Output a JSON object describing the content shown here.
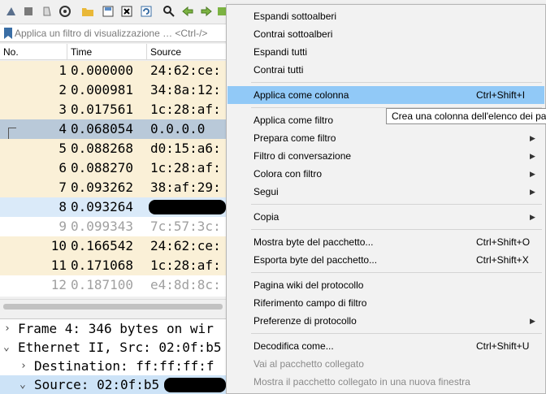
{
  "filter": {
    "placeholder": "Applica un filtro di visualizzazione … <Ctrl-/>"
  },
  "columns": {
    "no": "No.",
    "time": "Time",
    "source": "Source"
  },
  "packets": [
    {
      "no": "1",
      "time": "0.000000",
      "source": "24:62:ce:"
    },
    {
      "no": "2",
      "time": "0.000981",
      "source": "34:8a:12:"
    },
    {
      "no": "3",
      "time": "0.017561",
      "source": "1c:28:af:"
    },
    {
      "no": "4",
      "time": "0.068054",
      "source": "0.0.0.0"
    },
    {
      "no": "5",
      "time": "0.088268",
      "source": "d0:15:a6:"
    },
    {
      "no": "6",
      "time": "0.088270",
      "source": "1c:28:af:"
    },
    {
      "no": "7",
      "time": "0.093262",
      "source": "38:af:29:"
    },
    {
      "no": "8",
      "time": "0.093264",
      "source": ""
    },
    {
      "no": "9",
      "time": "0.099343",
      "source": "7c:57:3c:"
    },
    {
      "no": "10",
      "time": "0.166542",
      "source": "24:62:ce:"
    },
    {
      "no": "11",
      "time": "0.171068",
      "source": "1c:28:af:"
    },
    {
      "no": "12",
      "time": "0.187100",
      "source": "e4:8d:8c:"
    }
  ],
  "details": {
    "frame": "Frame 4: 346 bytes on wir",
    "ethernet": "Ethernet II, Src: 02:0f:b5",
    "destination": "Destination: ff:ff:ff:f",
    "source": "Source: 02:0f:b5"
  },
  "menu": {
    "expand_subtrees": "Espandi sottoalberi",
    "collapse_subtrees": "Contrai sottoalberi",
    "expand_all": "Espandi tutti",
    "collapse_all": "Contrai tutti",
    "apply_as_column": "Applica come colonna",
    "apply_as_column_shortcut": "Ctrl+Shift+I",
    "apply_as_filter": "Applica come filtro",
    "prepare_as_filter": "Prepara come filtro",
    "conversation_filter": "Filtro di conversazione",
    "colorize_with_filter": "Colora con filtro",
    "follow": "Segui",
    "copy": "Copia",
    "show_packet_bytes": "Mostra byte del pacchetto...",
    "show_packet_bytes_shortcut": "Ctrl+Shift+O",
    "export_packet_bytes": "Esporta byte del pacchetto...",
    "export_packet_bytes_shortcut": "Ctrl+Shift+X",
    "wiki_protocol_page": "Pagina wiki del protocollo",
    "filter_field_reference": "Riferimento campo di filtro",
    "protocol_preferences": "Preferenze di protocollo",
    "decode_as": "Decodifica come...",
    "decode_as_shortcut": "Ctrl+Shift+U",
    "go_to_linked_packet": "Vai al pacchetto collegato",
    "show_linked_packet_new_window": "Mostra il pacchetto collegato in una nuova finestra"
  },
  "tooltip": "Crea una colonna dell'elenco dei pac",
  "colors": {
    "row_beige": "#faf0d7",
    "row_selected": "#b9c9d9",
    "row_highlight": "#daeaf9",
    "menu_highlight": "#91c9f7",
    "disabled_text": "#8a8a8a"
  }
}
